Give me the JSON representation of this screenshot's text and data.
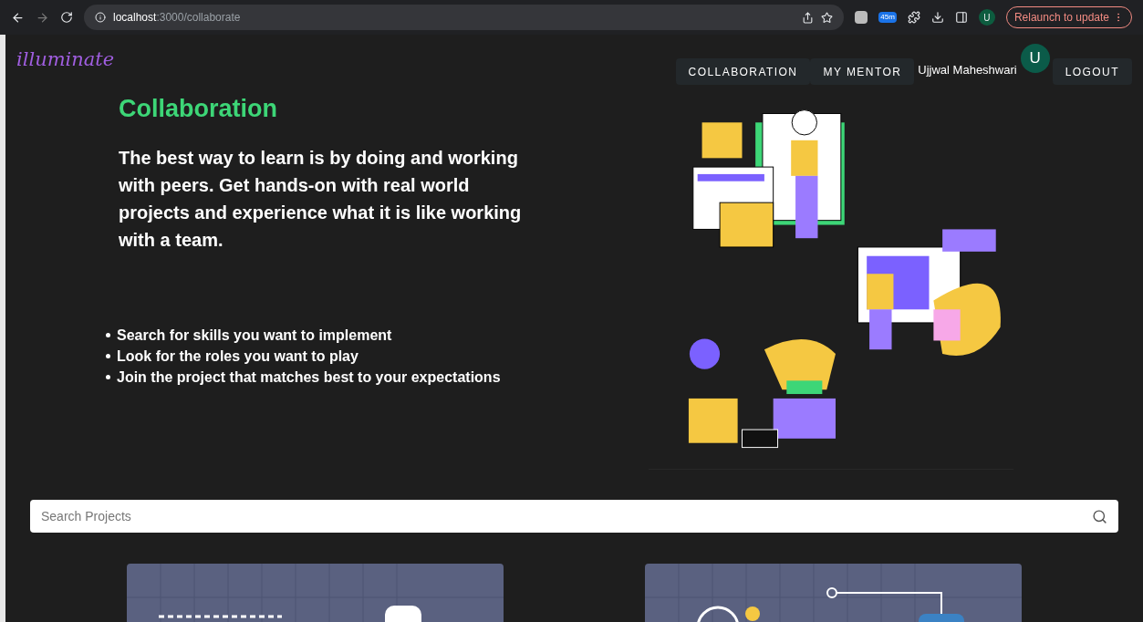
{
  "browser": {
    "url_host": "localhost",
    "url_path": ":3000/collaborate",
    "profile_initial": "U",
    "extension_badge": "45m",
    "relaunch_label": "Relaunch to update"
  },
  "header": {
    "logo": "illuminate",
    "nav": [
      {
        "label": "COLLABORATION"
      },
      {
        "label": "MY MENTOR"
      }
    ],
    "user_name": "Ujjwal Maheshwari",
    "avatar_initial": "U",
    "logout": "LOGOUT"
  },
  "hero": {
    "title": "Collaboration",
    "lead": "The best way to learn is by doing and working with peers. Get hands-on with real world projects and experience what it is like working with a team.",
    "bullets": [
      "Search for skills you want to implement",
      "Look for the roles you want to play",
      "Join the project that matches best to your expectations"
    ]
  },
  "search": {
    "placeholder": "Search Projects"
  },
  "projects": [
    {
      "kind": "flow"
    },
    {
      "kind": "network"
    }
  ]
}
